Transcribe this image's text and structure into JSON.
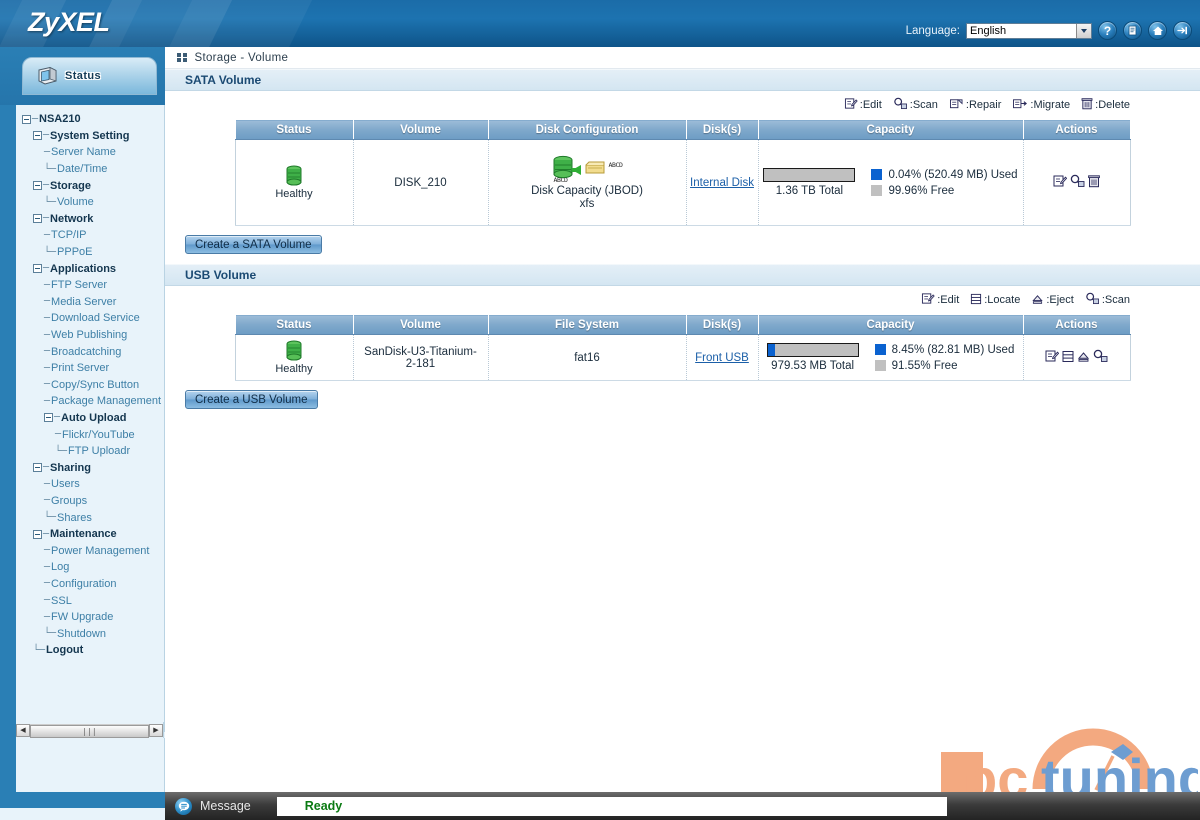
{
  "brand": {
    "logo_text": "ZyXEL"
  },
  "header": {
    "language_label": "Language:",
    "language_value": "English",
    "icons": [
      {
        "name": "help-icon",
        "glyph": "?"
      },
      {
        "name": "manual-icon",
        "glyph": "≡"
      },
      {
        "name": "home-icon",
        "glyph": "⌂"
      },
      {
        "name": "logout-icon",
        "glyph": "↦"
      }
    ]
  },
  "sidebar": {
    "status_tab_label": "Status",
    "tree": [
      {
        "label": "NSA210",
        "depth": 0,
        "kind": "root",
        "expander": true,
        "prefix": ""
      },
      {
        "label": "System Setting",
        "depth": 1,
        "kind": "branch",
        "expander": true,
        "prefix": ""
      },
      {
        "label": "Server Name",
        "depth": 2,
        "kind": "leaf",
        "expander": false,
        "prefix": "─"
      },
      {
        "label": "Date/Time",
        "depth": 2,
        "kind": "leaf",
        "expander": false,
        "prefix": "└─"
      },
      {
        "label": "Storage",
        "depth": 1,
        "kind": "branch",
        "expander": true,
        "prefix": ""
      },
      {
        "label": "Volume",
        "depth": 2,
        "kind": "leaf",
        "expander": false,
        "prefix": "└─"
      },
      {
        "label": "Network",
        "depth": 1,
        "kind": "branch",
        "expander": true,
        "prefix": ""
      },
      {
        "label": "TCP/IP",
        "depth": 2,
        "kind": "leaf",
        "expander": false,
        "prefix": "─"
      },
      {
        "label": "PPPoE",
        "depth": 2,
        "kind": "leaf",
        "expander": false,
        "prefix": "└─"
      },
      {
        "label": "Applications",
        "depth": 1,
        "kind": "branch",
        "expander": true,
        "prefix": ""
      },
      {
        "label": "FTP Server",
        "depth": 2,
        "kind": "leaf",
        "expander": false,
        "prefix": "─"
      },
      {
        "label": "Media Server",
        "depth": 2,
        "kind": "leaf",
        "expander": false,
        "prefix": "─"
      },
      {
        "label": "Download Service",
        "depth": 2,
        "kind": "leaf",
        "expander": false,
        "prefix": "─"
      },
      {
        "label": "Web Publishing",
        "depth": 2,
        "kind": "leaf",
        "expander": false,
        "prefix": "─"
      },
      {
        "label": "Broadcatching",
        "depth": 2,
        "kind": "leaf",
        "expander": false,
        "prefix": "─"
      },
      {
        "label": "Print Server",
        "depth": 2,
        "kind": "leaf",
        "expander": false,
        "prefix": "─"
      },
      {
        "label": "Copy/Sync Button",
        "depth": 2,
        "kind": "leaf",
        "expander": false,
        "prefix": "─"
      },
      {
        "label": "Package Management",
        "depth": 2,
        "kind": "leaf",
        "expander": false,
        "prefix": "─"
      },
      {
        "label": "Auto Upload",
        "depth": 2,
        "kind": "branch",
        "expander": true,
        "prefix": ""
      },
      {
        "label": "Flickr/YouTube",
        "depth": 3,
        "kind": "leaf",
        "expander": false,
        "prefix": "─"
      },
      {
        "label": "FTP Uploadr",
        "depth": 3,
        "kind": "leaf",
        "expander": false,
        "prefix": "└─"
      },
      {
        "label": "Sharing",
        "depth": 1,
        "kind": "branch",
        "expander": true,
        "prefix": ""
      },
      {
        "label": "Users",
        "depth": 2,
        "kind": "leaf",
        "expander": false,
        "prefix": "─"
      },
      {
        "label": "Groups",
        "depth": 2,
        "kind": "leaf",
        "expander": false,
        "prefix": "─"
      },
      {
        "label": "Shares",
        "depth": 2,
        "kind": "leaf",
        "expander": false,
        "prefix": "└─"
      },
      {
        "label": "Maintenance",
        "depth": 1,
        "kind": "branch",
        "expander": true,
        "prefix": ""
      },
      {
        "label": "Power Management",
        "depth": 2,
        "kind": "leaf",
        "expander": false,
        "prefix": "─"
      },
      {
        "label": "Log",
        "depth": 2,
        "kind": "leaf",
        "expander": false,
        "prefix": "─"
      },
      {
        "label": "Configuration",
        "depth": 2,
        "kind": "leaf",
        "expander": false,
        "prefix": "─"
      },
      {
        "label": "SSL",
        "depth": 2,
        "kind": "leaf",
        "expander": false,
        "prefix": "─"
      },
      {
        "label": "FW Upgrade",
        "depth": 2,
        "kind": "leaf",
        "expander": false,
        "prefix": "─"
      },
      {
        "label": "Shutdown",
        "depth": 2,
        "kind": "leaf",
        "expander": false,
        "prefix": "└─"
      },
      {
        "label": "Logout",
        "depth": 1,
        "kind": "branch",
        "expander": false,
        "prefix": "└─"
      }
    ]
  },
  "breadcrumb": {
    "text": "Storage - Volume"
  },
  "sata": {
    "section_title": "SATA Volume",
    "legend": [
      {
        "icon": "edit-icon",
        "label": ":Edit"
      },
      {
        "icon": "scan-icon",
        "label": ":Scan"
      },
      {
        "icon": "repair-icon",
        "label": ":Repair"
      },
      {
        "icon": "migrate-icon",
        "label": ":Migrate"
      },
      {
        "icon": "delete-icon",
        "label": ":Delete"
      }
    ],
    "columns": [
      "Status",
      "Volume",
      "Disk Configuration",
      "Disk(s)",
      "Capacity",
      "Actions"
    ],
    "row": {
      "status": "Healthy",
      "volume": "DISK_210",
      "disk_label_left": "ABCD",
      "disk_label_right": "ABCD",
      "config_name": "Disk Capacity (JBOD)",
      "filesystem": "xfs",
      "disks": "Internal Disk",
      "total": "1.36 TB Total",
      "used_text": "0.04% (520.49 MB) Used",
      "free_text": "99.96% Free",
      "used_percent": 0.04
    },
    "create_button": "Create a SATA Volume"
  },
  "usb": {
    "section_title": "USB Volume",
    "legend": [
      {
        "icon": "edit-icon",
        "label": ":Edit"
      },
      {
        "icon": "locate-icon",
        "label": ":Locate"
      },
      {
        "icon": "eject-icon",
        "label": ":Eject"
      },
      {
        "icon": "scan-icon",
        "label": ":Scan"
      }
    ],
    "columns": [
      "Status",
      "Volume",
      "File System",
      "Disk(s)",
      "Capacity",
      "Actions"
    ],
    "row": {
      "status": "Healthy",
      "volume": "SanDisk-U3-Titanium-2-181",
      "filesystem": "fat16",
      "disks": "Front USB",
      "total": "979.53 MB Total",
      "used_text": "8.45% (82.81 MB) Used",
      "free_text": "91.55% Free",
      "used_percent": 8.45
    },
    "create_button": "Create a USB Volume"
  },
  "statusbar": {
    "label": "Message",
    "text": "Ready"
  },
  "watermark": {
    "text_pc": "pc",
    "text_tuning": "tuning"
  },
  "colors": {
    "accent_blue": "#1b6ca8",
    "used_blue": "#0a62d0",
    "free_gray": "#c0c0c0",
    "healthy_green": "#2fae35",
    "ready_green": "#0a7a12",
    "link_blue": "#1b5fa8"
  }
}
